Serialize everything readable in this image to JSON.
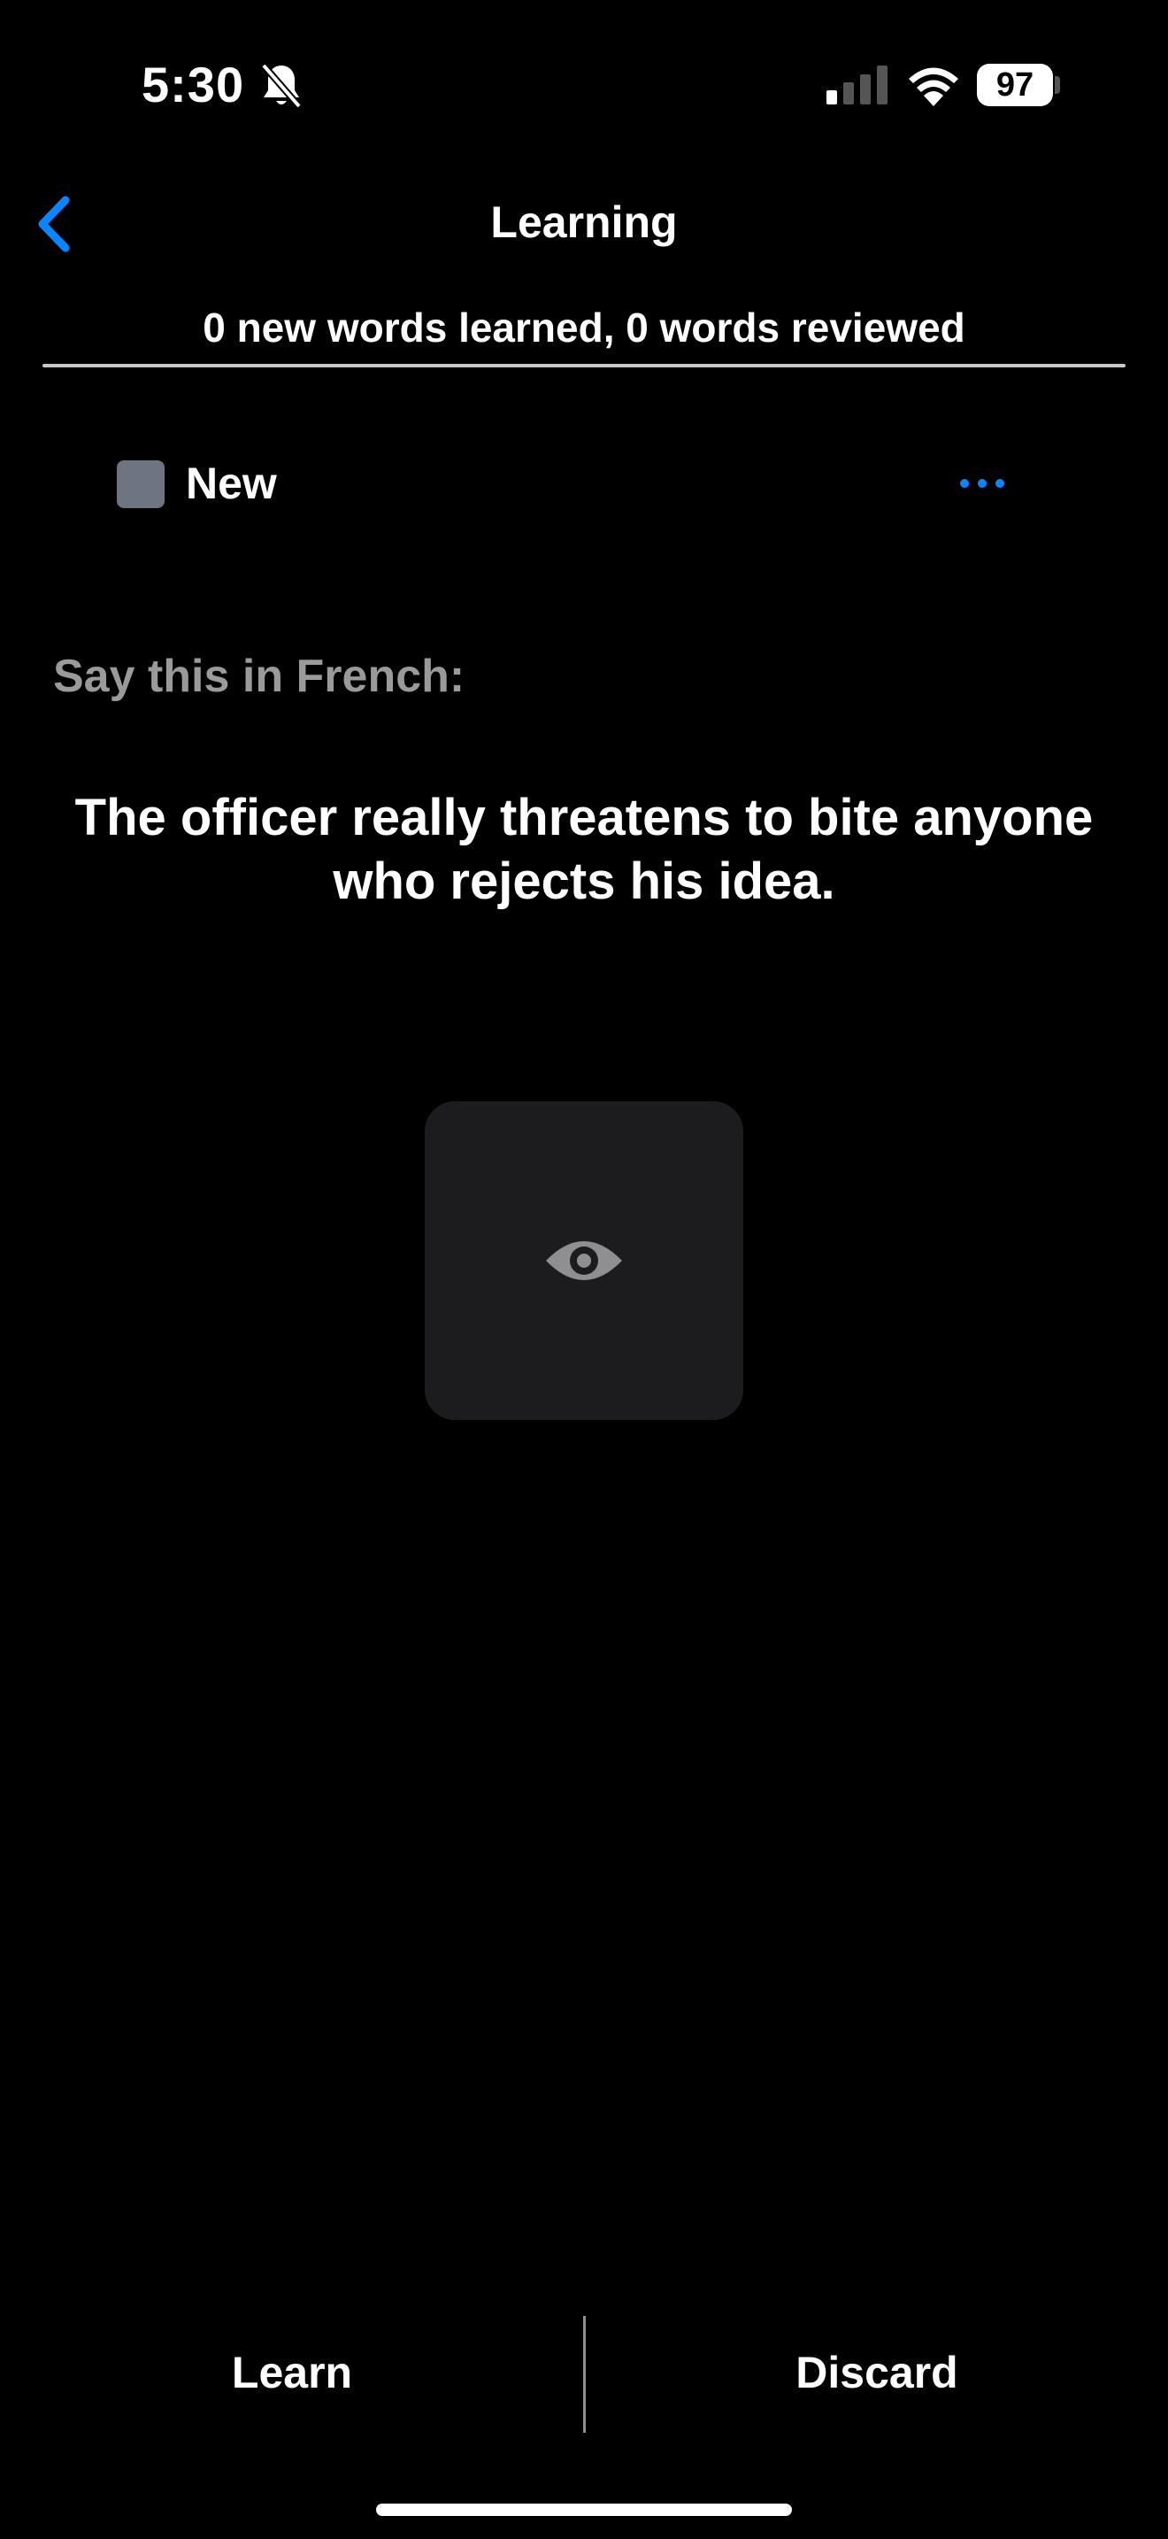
{
  "status_bar": {
    "time": "5:30",
    "battery": "97",
    "icons": [
      "bell-slash-icon",
      "cellular-signal-icon",
      "wifi-icon",
      "battery-icon"
    ]
  },
  "header": {
    "back_icon": "chevron-left-icon",
    "title": "Learning",
    "progress_text": "0 new words learned, 0 words reviewed"
  },
  "card_status": {
    "label": "New",
    "more_icon": "ellipsis-icon"
  },
  "prompt": {
    "label": "Say this in French:",
    "sentence": "The officer really threatens to bite anyone who rejects his idea."
  },
  "reveal": {
    "icon": "eye-icon"
  },
  "actions": {
    "learn_label": "Learn",
    "discard_label": "Discard"
  },
  "colors": {
    "accent": "#0a84ff",
    "background": "#000000",
    "tile": "#1c1c1e",
    "new_badge": "#6f7580",
    "muted_text": "#9a9a9a"
  }
}
